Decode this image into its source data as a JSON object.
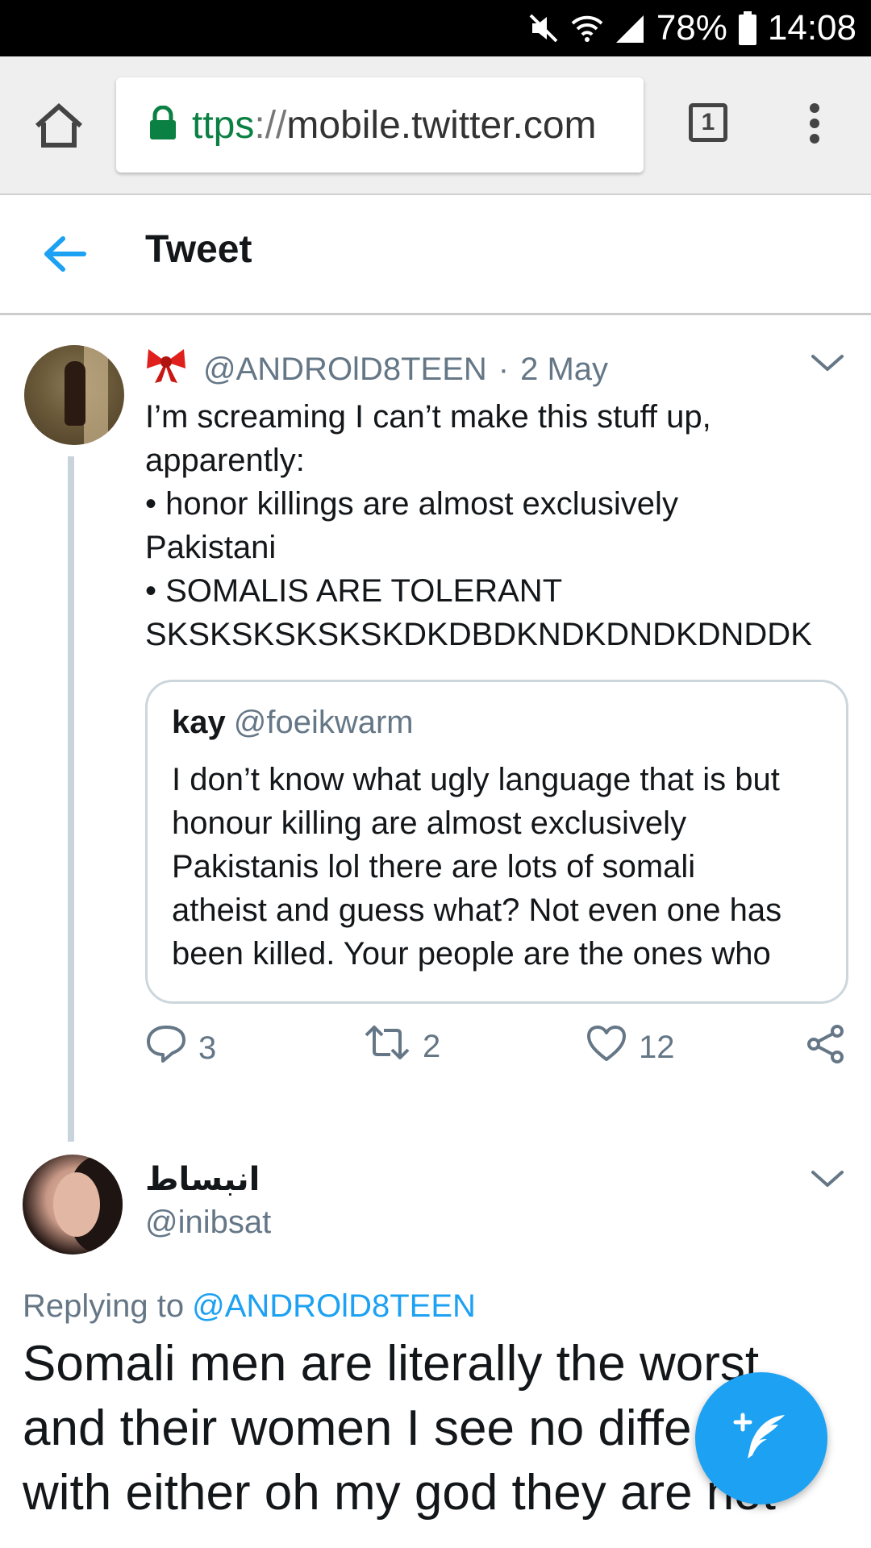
{
  "status_bar": {
    "battery": "78%",
    "time": "14:08",
    "icons": [
      "mute-icon",
      "wifi-icon",
      "signal-icon",
      "battery-icon"
    ]
  },
  "browser": {
    "url_scheme": "ttps",
    "url_sep": "://",
    "url_host": "mobile.twitter.com",
    "tab_count": "1",
    "icons": [
      "home-icon",
      "lock-icon",
      "tab-switcher-icon",
      "overflow-menu-icon"
    ]
  },
  "header": {
    "title": "Tweet",
    "back_icon": "back-arrow-icon"
  },
  "tweet": {
    "handle": "@ANDROlD8TEEN",
    "separator": "·",
    "date": "2 May",
    "lines": [
      "I’m screaming I can’t make this stuff up,",
      "apparently:",
      "• honor killings are almost exclusively",
      "Pakistani",
      "• SOMALIS ARE TOLERANT",
      "SKSKSKSKSKSKDKDBDKNDKDNDKDNDDK"
    ],
    "quote": {
      "name": "kay",
      "handle": "@foeikwarm",
      "lines": [
        "I don’t know what ugly language that is but",
        "honour killing are almost exclusively",
        "Pakistanis lol there are lots of somali",
        "atheist and guess what? Not even one has",
        "been killed. Your people are the ones who"
      ]
    },
    "actions": {
      "replies": "3",
      "retweets": "2",
      "likes": "12"
    }
  },
  "reply": {
    "name": "انبساط",
    "handle": "@inibsat",
    "replying_label": "Replying to",
    "replying_to": "@ANDROlD8TEEN",
    "lines": [
      "Somali men are literally the worst",
      "and their women I see no diffe",
      "with either oh my god they are not"
    ]
  },
  "colors": {
    "accent": "#1da1f2",
    "secondary_text": "#657786",
    "lock_green": "#0b8043"
  }
}
